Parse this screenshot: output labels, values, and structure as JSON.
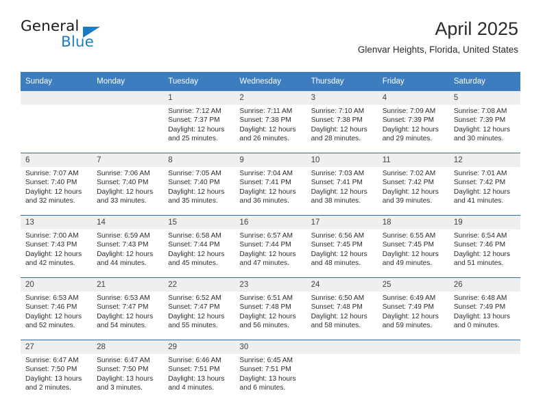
{
  "brand": {
    "name_top": "General",
    "name_bottom": "Blue",
    "accent_color": "#1a7dc4"
  },
  "header": {
    "title": "April 2025",
    "location": "Glenvar Heights, Florida, United States"
  },
  "calendar": {
    "header_bg": "#3b7dbf",
    "row_divider_color": "#2d6ca8",
    "daynum_bg": "#efefef",
    "weekday_headers": [
      "Sunday",
      "Monday",
      "Tuesday",
      "Wednesday",
      "Thursday",
      "Friday",
      "Saturday"
    ],
    "weeks": [
      [
        {
          "day": "",
          "sunrise": "",
          "sunset": "",
          "daylight": ""
        },
        {
          "day": "",
          "sunrise": "",
          "sunset": "",
          "daylight": ""
        },
        {
          "day": "1",
          "sunrise": "Sunrise: 7:12 AM",
          "sunset": "Sunset: 7:37 PM",
          "daylight": "Daylight: 12 hours and 25 minutes."
        },
        {
          "day": "2",
          "sunrise": "Sunrise: 7:11 AM",
          "sunset": "Sunset: 7:38 PM",
          "daylight": "Daylight: 12 hours and 26 minutes."
        },
        {
          "day": "3",
          "sunrise": "Sunrise: 7:10 AM",
          "sunset": "Sunset: 7:38 PM",
          "daylight": "Daylight: 12 hours and 28 minutes."
        },
        {
          "day": "4",
          "sunrise": "Sunrise: 7:09 AM",
          "sunset": "Sunset: 7:39 PM",
          "daylight": "Daylight: 12 hours and 29 minutes."
        },
        {
          "day": "5",
          "sunrise": "Sunrise: 7:08 AM",
          "sunset": "Sunset: 7:39 PM",
          "daylight": "Daylight: 12 hours and 30 minutes."
        }
      ],
      [
        {
          "day": "6",
          "sunrise": "Sunrise: 7:07 AM",
          "sunset": "Sunset: 7:40 PM",
          "daylight": "Daylight: 12 hours and 32 minutes."
        },
        {
          "day": "7",
          "sunrise": "Sunrise: 7:06 AM",
          "sunset": "Sunset: 7:40 PM",
          "daylight": "Daylight: 12 hours and 33 minutes."
        },
        {
          "day": "8",
          "sunrise": "Sunrise: 7:05 AM",
          "sunset": "Sunset: 7:40 PM",
          "daylight": "Daylight: 12 hours and 35 minutes."
        },
        {
          "day": "9",
          "sunrise": "Sunrise: 7:04 AM",
          "sunset": "Sunset: 7:41 PM",
          "daylight": "Daylight: 12 hours and 36 minutes."
        },
        {
          "day": "10",
          "sunrise": "Sunrise: 7:03 AM",
          "sunset": "Sunset: 7:41 PM",
          "daylight": "Daylight: 12 hours and 38 minutes."
        },
        {
          "day": "11",
          "sunrise": "Sunrise: 7:02 AM",
          "sunset": "Sunset: 7:42 PM",
          "daylight": "Daylight: 12 hours and 39 minutes."
        },
        {
          "day": "12",
          "sunrise": "Sunrise: 7:01 AM",
          "sunset": "Sunset: 7:42 PM",
          "daylight": "Daylight: 12 hours and 41 minutes."
        }
      ],
      [
        {
          "day": "13",
          "sunrise": "Sunrise: 7:00 AM",
          "sunset": "Sunset: 7:43 PM",
          "daylight": "Daylight: 12 hours and 42 minutes."
        },
        {
          "day": "14",
          "sunrise": "Sunrise: 6:59 AM",
          "sunset": "Sunset: 7:43 PM",
          "daylight": "Daylight: 12 hours and 44 minutes."
        },
        {
          "day": "15",
          "sunrise": "Sunrise: 6:58 AM",
          "sunset": "Sunset: 7:44 PM",
          "daylight": "Daylight: 12 hours and 45 minutes."
        },
        {
          "day": "16",
          "sunrise": "Sunrise: 6:57 AM",
          "sunset": "Sunset: 7:44 PM",
          "daylight": "Daylight: 12 hours and 47 minutes."
        },
        {
          "day": "17",
          "sunrise": "Sunrise: 6:56 AM",
          "sunset": "Sunset: 7:45 PM",
          "daylight": "Daylight: 12 hours and 48 minutes."
        },
        {
          "day": "18",
          "sunrise": "Sunrise: 6:55 AM",
          "sunset": "Sunset: 7:45 PM",
          "daylight": "Daylight: 12 hours and 49 minutes."
        },
        {
          "day": "19",
          "sunrise": "Sunrise: 6:54 AM",
          "sunset": "Sunset: 7:46 PM",
          "daylight": "Daylight: 12 hours and 51 minutes."
        }
      ],
      [
        {
          "day": "20",
          "sunrise": "Sunrise: 6:53 AM",
          "sunset": "Sunset: 7:46 PM",
          "daylight": "Daylight: 12 hours and 52 minutes."
        },
        {
          "day": "21",
          "sunrise": "Sunrise: 6:53 AM",
          "sunset": "Sunset: 7:47 PM",
          "daylight": "Daylight: 12 hours and 54 minutes."
        },
        {
          "day": "22",
          "sunrise": "Sunrise: 6:52 AM",
          "sunset": "Sunset: 7:47 PM",
          "daylight": "Daylight: 12 hours and 55 minutes."
        },
        {
          "day": "23",
          "sunrise": "Sunrise: 6:51 AM",
          "sunset": "Sunset: 7:48 PM",
          "daylight": "Daylight: 12 hours and 56 minutes."
        },
        {
          "day": "24",
          "sunrise": "Sunrise: 6:50 AM",
          "sunset": "Sunset: 7:48 PM",
          "daylight": "Daylight: 12 hours and 58 minutes."
        },
        {
          "day": "25",
          "sunrise": "Sunrise: 6:49 AM",
          "sunset": "Sunset: 7:49 PM",
          "daylight": "Daylight: 12 hours and 59 minutes."
        },
        {
          "day": "26",
          "sunrise": "Sunrise: 6:48 AM",
          "sunset": "Sunset: 7:49 PM",
          "daylight": "Daylight: 13 hours and 0 minutes."
        }
      ],
      [
        {
          "day": "27",
          "sunrise": "Sunrise: 6:47 AM",
          "sunset": "Sunset: 7:50 PM",
          "daylight": "Daylight: 13 hours and 2 minutes."
        },
        {
          "day": "28",
          "sunrise": "Sunrise: 6:47 AM",
          "sunset": "Sunset: 7:50 PM",
          "daylight": "Daylight: 13 hours and 3 minutes."
        },
        {
          "day": "29",
          "sunrise": "Sunrise: 6:46 AM",
          "sunset": "Sunset: 7:51 PM",
          "daylight": "Daylight: 13 hours and 4 minutes."
        },
        {
          "day": "30",
          "sunrise": "Sunrise: 6:45 AM",
          "sunset": "Sunset: 7:51 PM",
          "daylight": "Daylight: 13 hours and 6 minutes."
        },
        {
          "day": "",
          "sunrise": "",
          "sunset": "",
          "daylight": ""
        },
        {
          "day": "",
          "sunrise": "",
          "sunset": "",
          "daylight": ""
        },
        {
          "day": "",
          "sunrise": "",
          "sunset": "",
          "daylight": ""
        }
      ]
    ]
  }
}
